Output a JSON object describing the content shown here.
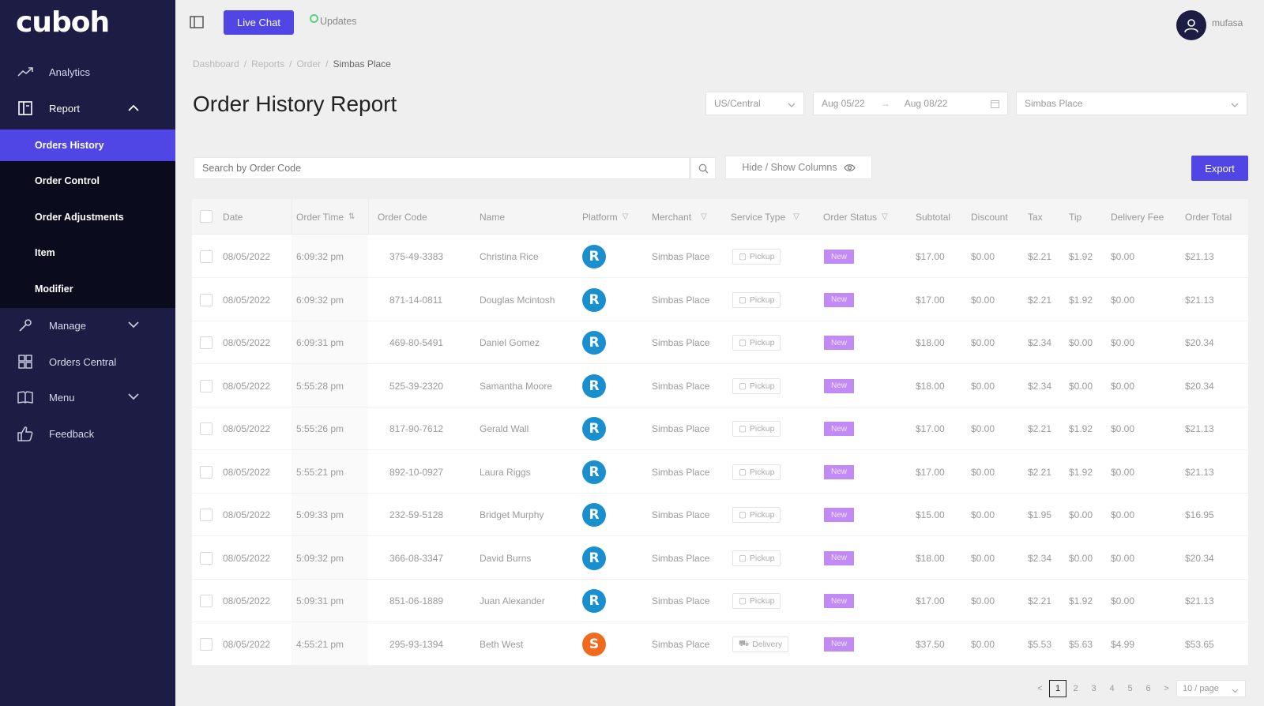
{
  "sidebar": {
    "logo": "cuboh",
    "items": [
      {
        "label": "Analytics",
        "icon": "trend-icon"
      },
      {
        "label": "Report",
        "icon": "report-icon"
      },
      {
        "label": "Manage",
        "icon": "wrench-icon"
      },
      {
        "label": "Orders Central",
        "icon": "grid-icon"
      },
      {
        "label": "Menu",
        "icon": "book-icon"
      },
      {
        "label": "Feedback",
        "icon": "thumbs-up-icon"
      }
    ],
    "report_submenu": [
      "Orders History",
      "Order Control",
      "Order Adjustments",
      "Item",
      "Modifier"
    ]
  },
  "topbar": {
    "live_chat": "Live Chat",
    "updates": "Updates",
    "username": "mufasa"
  },
  "breadcrumb": [
    "Dashboard",
    "Reports",
    "Order",
    "Simbas Place"
  ],
  "page_title": "Order History Report",
  "filters": {
    "timezone": "US/Central",
    "date_from": "Aug 05/22",
    "date_to": "Aug 08/22",
    "merchant": "Simbas Place"
  },
  "search": {
    "placeholder": "Search by Order Code"
  },
  "hide_show_label": "Hide / Show Columns",
  "export_label": "Export",
  "columns": [
    "Date",
    "Order Time",
    "Order Code",
    "Name",
    "Platform",
    "Merchant",
    "Service Type",
    "Order Status",
    "Subtotal",
    "Discount",
    "Tax",
    "Tip",
    "Delivery Fee",
    "Order Total"
  ],
  "rows": [
    {
      "date": "08/05/2022",
      "time": "6:09:32 pm",
      "code": "375-49-3383",
      "name": "Christina Rice",
      "platform": "R",
      "merchant": "Simbas Place",
      "service": "Pickup",
      "status": "New",
      "subtotal": "$17.00",
      "discount": "$0.00",
      "tax": "$2.21",
      "tip": "$1.92",
      "delivery": "$0.00",
      "total": "$21.13"
    },
    {
      "date": "08/05/2022",
      "time": "6:09:32 pm",
      "code": "871-14-0811",
      "name": "Douglas Mcintosh",
      "platform": "R",
      "merchant": "Simbas Place",
      "service": "Pickup",
      "status": "New",
      "subtotal": "$17.00",
      "discount": "$0.00",
      "tax": "$2.21",
      "tip": "$1.92",
      "delivery": "$0.00",
      "total": "$21.13"
    },
    {
      "date": "08/05/2022",
      "time": "6:09:31 pm",
      "code": "469-80-5491",
      "name": "Daniel Gomez",
      "platform": "R",
      "merchant": "Simbas Place",
      "service": "Pickup",
      "status": "New",
      "subtotal": "$18.00",
      "discount": "$0.00",
      "tax": "$2.34",
      "tip": "$0.00",
      "delivery": "$0.00",
      "total": "$20.34"
    },
    {
      "date": "08/05/2022",
      "time": "5:55:28 pm",
      "code": "525-39-2320",
      "name": "Samantha Moore",
      "platform": "R",
      "merchant": "Simbas Place",
      "service": "Pickup",
      "status": "New",
      "subtotal": "$18.00",
      "discount": "$0.00",
      "tax": "$2.34",
      "tip": "$0.00",
      "delivery": "$0.00",
      "total": "$20.34"
    },
    {
      "date": "08/05/2022",
      "time": "5:55:26 pm",
      "code": "817-90-7612",
      "name": "Gerald Wall",
      "platform": "R",
      "merchant": "Simbas Place",
      "service": "Pickup",
      "status": "New",
      "subtotal": "$17.00",
      "discount": "$0.00",
      "tax": "$2.21",
      "tip": "$1.92",
      "delivery": "$0.00",
      "total": "$21.13"
    },
    {
      "date": "08/05/2022",
      "time": "5:55:21 pm",
      "code": "892-10-0927",
      "name": "Laura Riggs",
      "platform": "R",
      "merchant": "Simbas Place",
      "service": "Pickup",
      "status": "New",
      "subtotal": "$17.00",
      "discount": "$0.00",
      "tax": "$2.21",
      "tip": "$1.92",
      "delivery": "$0.00",
      "total": "$21.13"
    },
    {
      "date": "08/05/2022",
      "time": "5:09:33 pm",
      "code": "232-59-5128",
      "name": "Bridget Murphy",
      "platform": "R",
      "merchant": "Simbas Place",
      "service": "Pickup",
      "status": "New",
      "subtotal": "$15.00",
      "discount": "$0.00",
      "tax": "$1.95",
      "tip": "$0.00",
      "delivery": "$0.00",
      "total": "$16.95"
    },
    {
      "date": "08/05/2022",
      "time": "5:09:32 pm",
      "code": "366-08-3347",
      "name": "David Burns",
      "platform": "R",
      "merchant": "Simbas Place",
      "service": "Pickup",
      "status": "New",
      "subtotal": "$18.00",
      "discount": "$0.00",
      "tax": "$2.34",
      "tip": "$0.00",
      "delivery": "$0.00",
      "total": "$20.34"
    },
    {
      "date": "08/05/2022",
      "time": "5:09:31 pm",
      "code": "851-06-1889",
      "name": "Juan Alexander",
      "platform": "R",
      "merchant": "Simbas Place",
      "service": "Pickup",
      "status": "New",
      "subtotal": "$17.00",
      "discount": "$0.00",
      "tax": "$2.21",
      "tip": "$1.92",
      "delivery": "$0.00",
      "total": "$21.13"
    },
    {
      "date": "08/05/2022",
      "time": "4:55:21 pm",
      "code": "295-93-1394",
      "name": "Beth West",
      "platform": "S",
      "merchant": "Simbas Place",
      "service": "Delivery",
      "status": "New",
      "subtotal": "$37.50",
      "discount": "$0.00",
      "tax": "$5.53",
      "tip": "$5.63",
      "delivery": "$4.99",
      "total": "$53.65"
    }
  ],
  "pagination": {
    "prev": "<",
    "pages": [
      "1",
      "2",
      "3",
      "4",
      "5",
      "6"
    ],
    "next": ">",
    "per_page": "10 / page"
  },
  "colors": {
    "sidebar": "#1c1c44",
    "accent": "#4f46e5",
    "status_new": "#c18af5",
    "platform_r": "#1a8fd0",
    "platform_s": "#f26b1d"
  }
}
